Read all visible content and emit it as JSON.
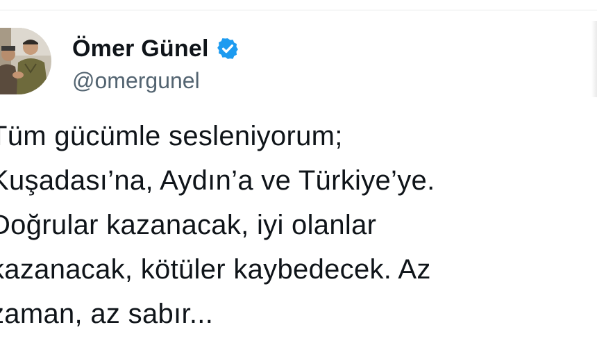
{
  "tweet": {
    "author": {
      "display_name": "Ömer Günel",
      "handle": "@omergunel",
      "avatar_icon": "avatar-photo",
      "verified_icon": "verified-badge-icon",
      "verified_color": "#1d9bf0"
    },
    "text_lines": [
      "Tüm gücümle sesleniyorum;",
      "Kuşadası’na, Aydın’a ve Türkiye’ye.",
      "Doğrular kazanacak, iyi olanlar",
      "kazanacak, kötüler kaybedecek. Az",
      "zaman, az sabır..."
    ]
  }
}
